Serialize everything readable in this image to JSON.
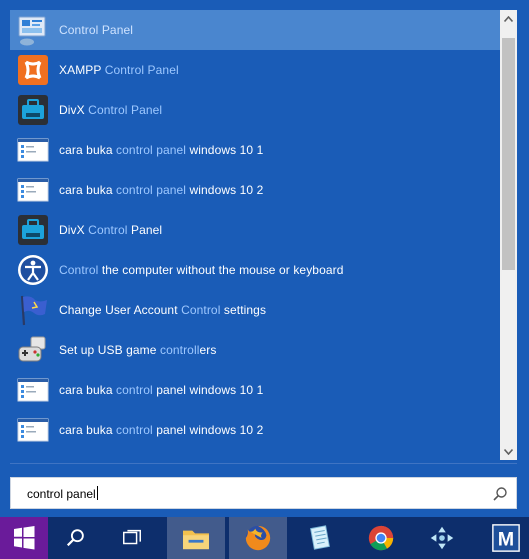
{
  "results": [
    {
      "parts": [
        {
          "t": "Control Panel",
          "h": true
        }
      ],
      "icon": "control-panel-icon",
      "selected": true
    },
    {
      "parts": [
        {
          "t": "XAMPP ",
          "h": false
        },
        {
          "t": "Control Panel",
          "h": true
        }
      ],
      "icon": "xampp-icon"
    },
    {
      "parts": [
        {
          "t": "DivX ",
          "h": false
        },
        {
          "t": "Control Panel",
          "h": true
        }
      ],
      "icon": "divx-icon"
    },
    {
      "parts": [
        {
          "t": "cara buka ",
          "h": false
        },
        {
          "t": "control panel",
          "h": true
        },
        {
          "t": " windows 10 1",
          "h": false
        }
      ],
      "icon": "image-file-icon"
    },
    {
      "parts": [
        {
          "t": "cara buka ",
          "h": false
        },
        {
          "t": "control panel",
          "h": true
        },
        {
          "t": " windows 10 2",
          "h": false
        }
      ],
      "icon": "image-file-icon"
    },
    {
      "parts": [
        {
          "t": "DivX ",
          "h": false
        },
        {
          "t": "Control",
          "h": true
        },
        {
          "t": " Panel",
          "h": false
        }
      ],
      "icon": "divx-icon"
    },
    {
      "parts": [
        {
          "t": "Control",
          "h": true
        },
        {
          "t": " the computer without the mouse or keyboard",
          "h": false
        }
      ],
      "icon": "ease-of-access-icon"
    },
    {
      "parts": [
        {
          "t": "Change User Account ",
          "h": false
        },
        {
          "t": "Control",
          "h": true
        },
        {
          "t": " settings",
          "h": false
        }
      ],
      "icon": "uac-flag-icon"
    },
    {
      "parts": [
        {
          "t": "Set up USB game ",
          "h": false
        },
        {
          "t": "controll",
          "h": true
        },
        {
          "t": "ers",
          "h": false
        }
      ],
      "icon": "game-controller-icon"
    },
    {
      "parts": [
        {
          "t": "cara buka ",
          "h": false
        },
        {
          "t": "control",
          "h": true
        },
        {
          "t": " panel windows 10 1",
          "h": false
        }
      ],
      "icon": "image-file-icon"
    },
    {
      "parts": [
        {
          "t": "cara buka ",
          "h": false
        },
        {
          "t": "control",
          "h": true
        },
        {
          "t": " panel windows 10 2",
          "h": false
        }
      ],
      "icon": "image-file-icon"
    }
  ],
  "search": {
    "value": "control panel"
  },
  "taskbar": [
    {
      "name": "start-button",
      "icon": "windows-logo-icon"
    },
    {
      "name": "search-button",
      "icon": "search-icon"
    },
    {
      "name": "task-view-button",
      "icon": "task-view-icon"
    },
    {
      "name": "file-explorer-button",
      "icon": "folder-icon",
      "active": true
    },
    {
      "name": "firefox-button",
      "icon": "firefox-icon",
      "active": true
    },
    {
      "name": "notepad-button",
      "icon": "notepad-icon"
    },
    {
      "name": "chrome-button",
      "icon": "chrome-icon"
    },
    {
      "name": "ppsspp-button",
      "icon": "psp-icon"
    },
    {
      "name": "m-app-button",
      "icon": "m-app-icon"
    }
  ],
  "colors": {
    "panel": "#1a5cb7",
    "selected": "#4a86cf",
    "highlight": "#9ec8ff",
    "taskbar": "#0d2e6c"
  }
}
